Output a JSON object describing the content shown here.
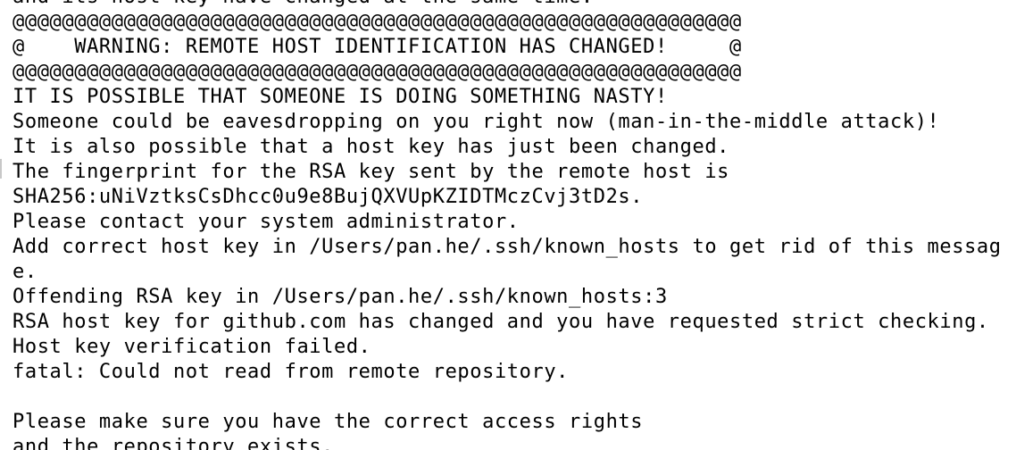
{
  "terminal": {
    "lines": [
      "and its host key have changed at the same time.",
      "@@@@@@@@@@@@@@@@@@@@@@@@@@@@@@@@@@@@@@@@@@@@@@@@@@@@@@@@@@@",
      "@    WARNING: REMOTE HOST IDENTIFICATION HAS CHANGED!     @",
      "@@@@@@@@@@@@@@@@@@@@@@@@@@@@@@@@@@@@@@@@@@@@@@@@@@@@@@@@@@@",
      "IT IS POSSIBLE THAT SOMEONE IS DOING SOMETHING NASTY!",
      "Someone could be eavesdropping on you right now (man-in-the-middle attack)!",
      "It is also possible that a host key has just been changed.",
      "The fingerprint for the RSA key sent by the remote host is",
      "SHA256:uNiVztksCsDhcc0u9e8BujQXVUpKZIDTMczCvj3tD2s.",
      "Please contact your system administrator.",
      "Add correct host key in /Users/pan.he/.ssh/known_hosts to get rid of this messag",
      "e.",
      "Offending RSA key in /Users/pan.he/.ssh/known_hosts:3",
      "RSA host key for github.com has changed and you have requested strict checking.",
      "Host key verification failed.",
      "fatal: Could not read from remote repository.",
      "",
      "Please make sure you have the correct access rights",
      "and the repository exists."
    ]
  }
}
